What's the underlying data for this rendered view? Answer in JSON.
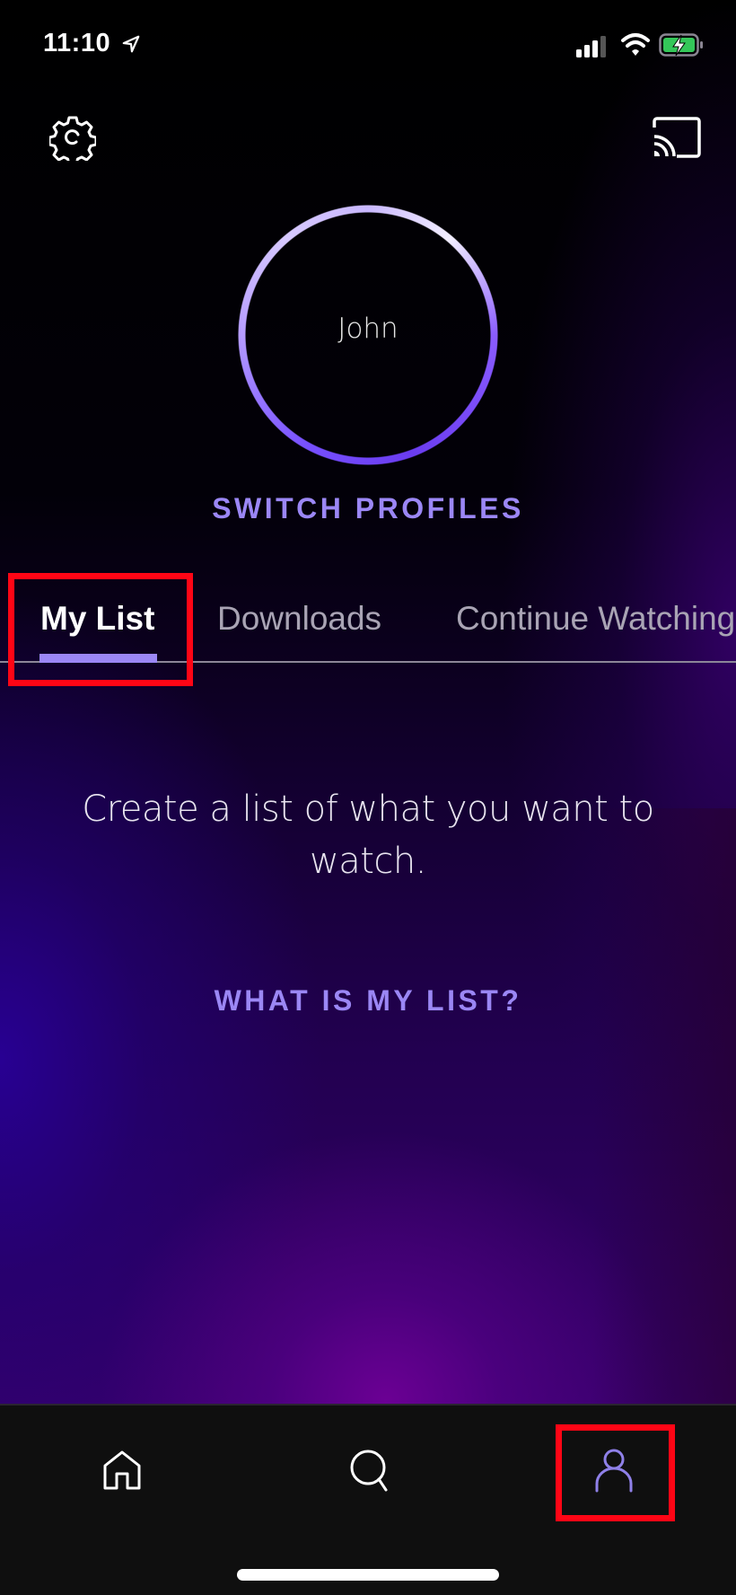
{
  "status_bar": {
    "time": "11:10",
    "icons": [
      "location-arrow-icon",
      "cellular-signal-icon",
      "wifi-icon",
      "battery-charging-icon"
    ],
    "battery_color": "#34c759"
  },
  "header": {
    "settings_icon": "gear-icon",
    "cast_icon": "cast-icon"
  },
  "profile": {
    "name": "John",
    "switch_label": "SWITCH PROFILES",
    "ring_color": "#7b5cff"
  },
  "tabs": [
    {
      "label": "My List",
      "active": true
    },
    {
      "label": "Downloads",
      "active": false
    },
    {
      "label": "Continue Watching",
      "active": false
    }
  ],
  "empty_state": {
    "message": "Create a list of what you want to watch.",
    "link_label": "WHAT IS MY LIST?"
  },
  "bottom_nav": {
    "items": [
      {
        "name": "home",
        "icon": "home-icon",
        "active": false
      },
      {
        "name": "search",
        "icon": "search-icon",
        "active": false
      },
      {
        "name": "profile",
        "icon": "profile-icon",
        "active": true
      }
    ]
  },
  "colors": {
    "accent": "#9b87f5",
    "inactive_tab": "#a9a4b4",
    "nav_background": "#0f0f0f",
    "annotation": "#ff0515"
  }
}
